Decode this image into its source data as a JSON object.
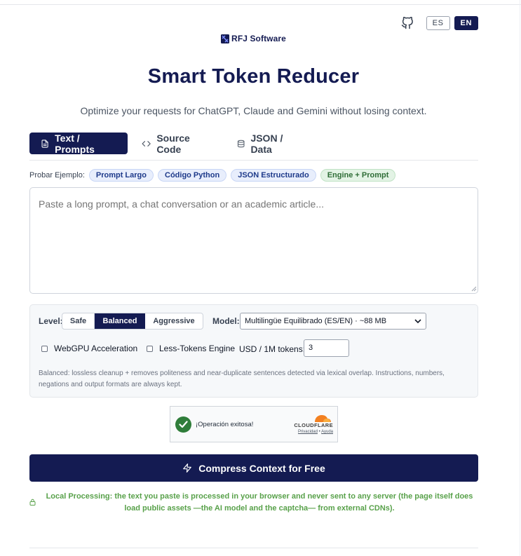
{
  "header": {
    "github_icon": "github-icon",
    "lang_es": "ES",
    "lang_en": "EN",
    "active_lang": "EN"
  },
  "brand": {
    "name": "RFJ Software",
    "color": "#141b52"
  },
  "title": "Smart Token Reducer",
  "subtitle": "Optimize your requests for ChatGPT, Claude and Gemini without losing context.",
  "tabs": [
    {
      "label": "Text / Prompts",
      "icon": "file-text-icon",
      "active": true
    },
    {
      "label": "Source Code",
      "icon": "code-icon",
      "active": false
    },
    {
      "label": "JSON / Data",
      "icon": "database-icon",
      "active": false
    }
  ],
  "examples": {
    "label": "Probar Ejemplo:",
    "chips": [
      "Prompt Largo",
      "Código Python",
      "JSON Estructurado",
      "Engine + Prompt"
    ]
  },
  "input": {
    "placeholder": "Paste a long prompt, a chat conversation or an academic article..."
  },
  "settings": {
    "level_label": "Level:",
    "levels": [
      "Safe",
      "Balanced",
      "Aggressive"
    ],
    "selected_level": "Balanced",
    "model_label": "Model:",
    "model_value": "Multilingüe Equilibrado (ES/EN) · ~88 MB",
    "webgpu_label": "WebGPU Acceleration",
    "webgpu_checked": false,
    "less_tokens_label": "Less-Tokens Engine",
    "less_tokens_checked": false,
    "usd_label": "USD / 1M tokens:",
    "usd_value": "3",
    "description": "Balanced: lossless cleanup + removes politeness and near-duplicate sentences detected via lexical overlap. Instructions, numbers, negations and output formats are always kept."
  },
  "captcha": {
    "status": "¡Operación exitosa!",
    "provider": "CLOUDFLARE",
    "privacy": "Privacidad",
    "separator": "•",
    "help": "Ayuda"
  },
  "action": {
    "compress_label": "Compress Context for Free",
    "icon": "lightning-icon"
  },
  "privacy_note": "Local Processing: the text you paste is processed in your browser and never sent to any server (the page itself does load public assets —the AI model and the captcha— from external CDNs).",
  "colors": {
    "primary": "#141b52",
    "success_green": "#58a14a",
    "chip_blue_bg": "#e8eefc",
    "chip_green_bg": "#e3f3e5",
    "cloudflare_orange": "#f38020"
  }
}
